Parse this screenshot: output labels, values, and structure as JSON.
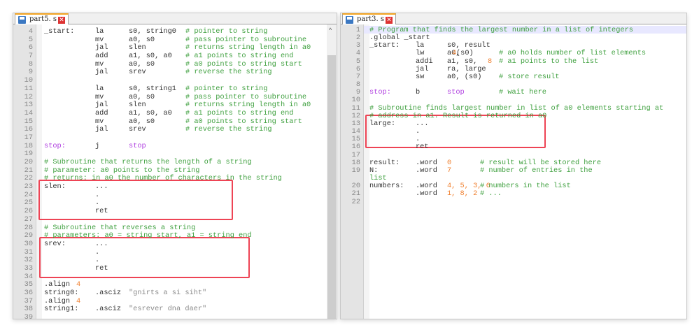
{
  "left": {
    "tab": "part5. s",
    "lines": [
      {
        "n": "4",
        "s": [
          [
            0,
            "_start:",
            "def"
          ],
          [
            1,
            "la",
            "def"
          ],
          [
            2,
            "s0, string0",
            "def"
          ],
          [
            3,
            "# pointer to string",
            "com"
          ]
        ]
      },
      {
        "n": "5",
        "s": [
          [
            1,
            "mv",
            "def"
          ],
          [
            2,
            "a0, s0",
            "def"
          ],
          [
            3,
            "# pass pointer to subroutine",
            "com"
          ]
        ]
      },
      {
        "n": "6",
        "s": [
          [
            1,
            "jal",
            "def"
          ],
          [
            2,
            "slen",
            "def"
          ],
          [
            3,
            "# returns string length in a0",
            "com"
          ]
        ]
      },
      {
        "n": "7",
        "s": [
          [
            1,
            "add",
            "def"
          ],
          [
            2,
            "a1, s0, a0",
            "def"
          ],
          [
            3,
            "# a1 points to string end",
            "com"
          ]
        ]
      },
      {
        "n": "8",
        "s": [
          [
            1,
            "mv",
            "def"
          ],
          [
            2,
            "a0, s0",
            "def"
          ],
          [
            3,
            "# a0 points to string start",
            "com"
          ]
        ]
      },
      {
        "n": "9",
        "s": [
          [
            1,
            "jal",
            "def"
          ],
          [
            2,
            "srev",
            "def"
          ],
          [
            3,
            "# reverse the string",
            "com"
          ]
        ]
      },
      {
        "n": "10",
        "s": []
      },
      {
        "n": "11",
        "s": [
          [
            1,
            "la",
            "def"
          ],
          [
            2,
            "s0, string1",
            "def"
          ],
          [
            3,
            "# pointer to string",
            "com"
          ]
        ]
      },
      {
        "n": "12",
        "s": [
          [
            1,
            "mv",
            "def"
          ],
          [
            2,
            "a0, s0",
            "def"
          ],
          [
            3,
            "# pass pointer to subroutine",
            "com"
          ]
        ]
      },
      {
        "n": "13",
        "s": [
          [
            1,
            "jal",
            "def"
          ],
          [
            2,
            "slen",
            "def"
          ],
          [
            3,
            "# returns string length in a0",
            "com"
          ]
        ]
      },
      {
        "n": "14",
        "s": [
          [
            1,
            "add",
            "def"
          ],
          [
            2,
            "a1, s0, a0",
            "def"
          ],
          [
            3,
            "# a1 points to string end",
            "com"
          ]
        ]
      },
      {
        "n": "15",
        "s": [
          [
            1,
            "mv",
            "def"
          ],
          [
            2,
            "a0, s0",
            "def"
          ],
          [
            3,
            "# a0 points to string start",
            "com"
          ]
        ]
      },
      {
        "n": "16",
        "s": [
          [
            1,
            "jal",
            "def"
          ],
          [
            2,
            "srev",
            "def"
          ],
          [
            3,
            "# reverse the string",
            "com"
          ]
        ]
      },
      {
        "n": "17",
        "s": []
      },
      {
        "n": "18",
        "s": [
          [
            0,
            "stop:",
            "lab"
          ],
          [
            1,
            "j",
            "def"
          ],
          [
            2,
            "stop",
            "lab"
          ]
        ]
      },
      {
        "n": "19",
        "s": []
      },
      {
        "n": "20",
        "s": [
          [
            0,
            "# Subroutine that returns the length of a string",
            "com"
          ]
        ]
      },
      {
        "n": "21",
        "s": [
          [
            0,
            "# parameter: a0 points to the string",
            "com"
          ]
        ]
      },
      {
        "n": "22",
        "s": [
          [
            0,
            "# returns: in a0 the number of characters in the string",
            "com"
          ]
        ]
      },
      {
        "n": "23",
        "s": [
          [
            0,
            "slen:",
            "def"
          ],
          [
            1,
            "...",
            "def"
          ]
        ]
      },
      {
        "n": "24",
        "s": [
          [
            1,
            ".",
            "def"
          ]
        ]
      },
      {
        "n": "25",
        "s": [
          [
            1,
            ".",
            "def"
          ]
        ]
      },
      {
        "n": "26",
        "s": [
          [
            1,
            "ret",
            "def"
          ]
        ]
      },
      {
        "n": "27",
        "s": []
      },
      {
        "n": "28",
        "s": [
          [
            0,
            "# Subroutine that reverses a string",
            "com"
          ]
        ]
      },
      {
        "n": "29",
        "s": [
          [
            0,
            "# parameters: a0 = string start, a1 = string end",
            "com"
          ]
        ]
      },
      {
        "n": "30",
        "s": [
          [
            0,
            "srev:",
            "def"
          ],
          [
            1,
            "...",
            "def"
          ]
        ]
      },
      {
        "n": "31",
        "s": [
          [
            1,
            ".",
            "def"
          ]
        ]
      },
      {
        "n": "32",
        "s": [
          [
            1,
            ".",
            "def"
          ]
        ]
      },
      {
        "n": "33",
        "s": [
          [
            1,
            "ret",
            "def"
          ]
        ]
      },
      {
        "n": "34",
        "s": []
      },
      {
        "n": "35",
        "s": [
          [
            0,
            ".align",
            "def"
          ],
          [
            4,
            "4",
            "num"
          ]
        ]
      },
      {
        "n": "36",
        "s": [
          [
            0,
            "string0:",
            "def"
          ],
          [
            1,
            ".asciz",
            "def"
          ],
          [
            5,
            "\"gnirts a si siht\"",
            "str"
          ]
        ]
      },
      {
        "n": "37",
        "s": [
          [
            0,
            ".align",
            "def"
          ],
          [
            4,
            "4",
            "num"
          ]
        ]
      },
      {
        "n": "38",
        "s": [
          [
            0,
            "string1:",
            "def"
          ],
          [
            1,
            ".asciz",
            "def"
          ],
          [
            5,
            "\"esrever dna daer\"",
            "str"
          ]
        ]
      },
      {
        "n": "39",
        "s": []
      }
    ]
  },
  "right": {
    "tab": "part3. s",
    "lines": [
      {
        "n": "1",
        "s": [
          [
            0,
            "# Program that finds the largest number in a list of integers",
            "com"
          ]
        ]
      },
      {
        "n": "2",
        "s": [
          [
            0,
            ".global _start",
            "def"
          ]
        ]
      },
      {
        "n": "3",
        "s": [
          [
            0,
            "_start:",
            "def"
          ],
          [
            1,
            "la",
            "def"
          ],
          [
            2,
            "s0, result",
            "def"
          ]
        ]
      },
      {
        "n": "4",
        "s": [
          [
            1,
            "lw",
            "def"
          ],
          [
            2,
            "a0, ",
            "def"
          ],
          [
            6,
            "4",
            "num"
          ],
          [
            7,
            "(s0)",
            "def"
          ],
          [
            3,
            "# a0 holds number of list elements",
            "com"
          ]
        ]
      },
      {
        "n": "5",
        "s": [
          [
            1,
            "addi",
            "def"
          ],
          [
            2,
            "a1, s0, ",
            "def"
          ],
          [
            8,
            "8",
            "num"
          ],
          [
            3,
            "# a1 points to the list",
            "com"
          ]
        ]
      },
      {
        "n": "6",
        "s": [
          [
            1,
            "jal",
            "def"
          ],
          [
            2,
            "ra, large",
            "def"
          ]
        ]
      },
      {
        "n": "7",
        "s": [
          [
            1,
            "sw",
            "def"
          ],
          [
            2,
            "a0, (s0)",
            "def"
          ],
          [
            3,
            "# store result",
            "com"
          ]
        ]
      },
      {
        "n": "8",
        "s": []
      },
      {
        "n": "9",
        "s": [
          [
            0,
            "stop:",
            "lab"
          ],
          [
            1,
            "b",
            "def"
          ],
          [
            2,
            "stop",
            "lab"
          ],
          [
            3,
            "# wait here",
            "com"
          ]
        ]
      },
      {
        "n": "10",
        "s": []
      },
      {
        "n": "11",
        "s": [
          [
            0,
            "# Subroutine finds largest number in list of a0 elements starting at",
            "com"
          ]
        ]
      },
      {
        "n": "12",
        "s": [
          [
            0,
            "# address in a1. Result is returned in a0",
            "com"
          ]
        ]
      },
      {
        "n": "13",
        "s": [
          [
            0,
            "large:",
            "def"
          ],
          [
            1,
            "...",
            "def"
          ]
        ]
      },
      {
        "n": "14",
        "s": [
          [
            1,
            ".",
            "def"
          ]
        ]
      },
      {
        "n": "15",
        "s": [
          [
            1,
            ".",
            "def"
          ]
        ]
      },
      {
        "n": "16",
        "s": [
          [
            1,
            "ret",
            "def"
          ]
        ]
      },
      {
        "n": "17",
        "s": []
      },
      {
        "n": "18",
        "s": [
          [
            0,
            "result:",
            "def"
          ],
          [
            1,
            ".word",
            "def"
          ],
          [
            2,
            "0",
            "num"
          ],
          [
            9,
            "# result will be stored here",
            "com"
          ]
        ]
      },
      {
        "n": "19",
        "s": [
          [
            0,
            "N:",
            "def"
          ],
          [
            1,
            ".word",
            "def"
          ],
          [
            2,
            "7",
            "num"
          ],
          [
            9,
            "# number of entries in the",
            "com"
          ]
        ]
      },
      {
        "n": "",
        "s": [
          [
            0,
            "list",
            "com"
          ]
        ]
      },
      {
        "n": "20",
        "s": [
          [
            0,
            "numbers:",
            "def"
          ],
          [
            1,
            ".word",
            "def"
          ],
          [
            2,
            "4, 5, 3, 6",
            "num"
          ],
          [
            9,
            "# numbers in the list",
            "com"
          ]
        ]
      },
      {
        "n": "21",
        "s": [
          [
            1,
            ".word",
            "def"
          ],
          [
            2,
            "1, 8, 2",
            "num"
          ],
          [
            9,
            "# ...",
            "com"
          ]
        ]
      },
      {
        "n": "22",
        "s": []
      }
    ]
  },
  "colors": {
    "comment": "#3fa03f",
    "label": "#b040e0",
    "number": "#f08030",
    "string": "#8a8a8a",
    "highlight": "#ee4455"
  }
}
